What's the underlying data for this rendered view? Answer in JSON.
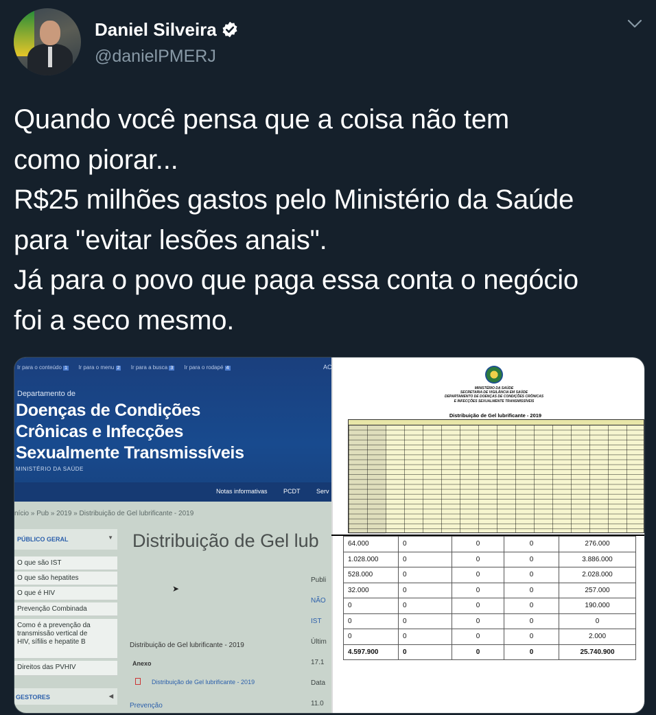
{
  "tweet": {
    "author_name": "Daniel Silveira",
    "handle": "@danielPMERJ",
    "text": "Quando você pensa que a coisa não tem\ncomo piorar...\nR$25 milhões gastos pelo Ministério da Saúde\npara \"evitar lesões anais\".\nJá para o povo que paga essa conta o negócio\nfoi a seco mesmo."
  },
  "colors": {
    "background": "#15202b",
    "text": "#ffffff",
    "secondary_text": "#8899a6",
    "verified_badge": "#ffffff"
  },
  "icons": [
    "verified-badge-icon",
    "chevron-down-icon",
    "pdf-file-icon"
  ],
  "photo_site": {
    "skip_links": [
      {
        "label": "Ir para o conteúdo",
        "num": "1"
      },
      {
        "label": "Ir para o menu",
        "num": "2"
      },
      {
        "label": "Ir para a busca",
        "num": "3"
      },
      {
        "label": "Ir para o rodapé",
        "num": "4"
      }
    ],
    "corner": "AC",
    "department_label": "Departamento de",
    "title": "Doenças de Condições\nCrônicas e Infecções\nSexualmente Transmissíveis",
    "ministry": "MINISTÉRIO DA SAÚDE",
    "nav": [
      "Notas informativas",
      "PCDT",
      "Serv"
    ],
    "breadcrumb": "nício » Pub » 2019 » Distribuição de Gel lubrificante - 2019",
    "sidebar_header": "PÚBLICO GERAL",
    "sidebar_items": [
      "O que são IST",
      "O que são hepatites",
      "O que é HIV",
      "Prevenção Combinada",
      "Como é a prevenção da\ntransmissão vertical de\nHIV, sífilis e hepatite B",
      "Direitos das PVHIV"
    ],
    "sidebar_footer": "GESTORES",
    "page_heading": "Distribuição de Gel lub",
    "meta_lines": [
      "Publi",
      "NÃO",
      "IST",
      "Últim",
      "17.1",
      "Data",
      "11.0"
    ],
    "document_label": "Distribuição de Gel lubrificante - 2019",
    "attachment_label": "Anexo",
    "file_link": "Distribuição de Gel lubrificante - 2019",
    "footer_link": "Prevenção"
  },
  "photo_document": {
    "header_lines": [
      "MINISTÉRIO DA SAÚDE",
      "SECRETARIA DE VIGILÂNCIA EM SAÚDE",
      "DEPARTAMENTO DE DOENÇAS DE CONDIÇÕES CRÔNICAS",
      "E INFECÇÕES SEXUALMENTE TRANSMISSÍVEIS"
    ],
    "table_title": "Distribuição de Gel lubrificante - 2019"
  },
  "photo_totals": {
    "rows": [
      [
        "64.000",
        "0",
        "0",
        "0",
        "276.000"
      ],
      [
        "1.028.000",
        "0",
        "0",
        "0",
        "3.886.000"
      ],
      [
        "528.000",
        "0",
        "0",
        "0",
        "2.028.000"
      ],
      [
        "32.000",
        "0",
        "0",
        "0",
        "257.000"
      ],
      [
        "0",
        "0",
        "0",
        "0",
        "190.000"
      ],
      [
        "0",
        "0",
        "0",
        "0",
        "0"
      ],
      [
        "0",
        "0",
        "0",
        "0",
        "2.000"
      ]
    ],
    "total_row": [
      "4.597.900",
      "0",
      "0",
      "0",
      "25.740.900"
    ]
  }
}
